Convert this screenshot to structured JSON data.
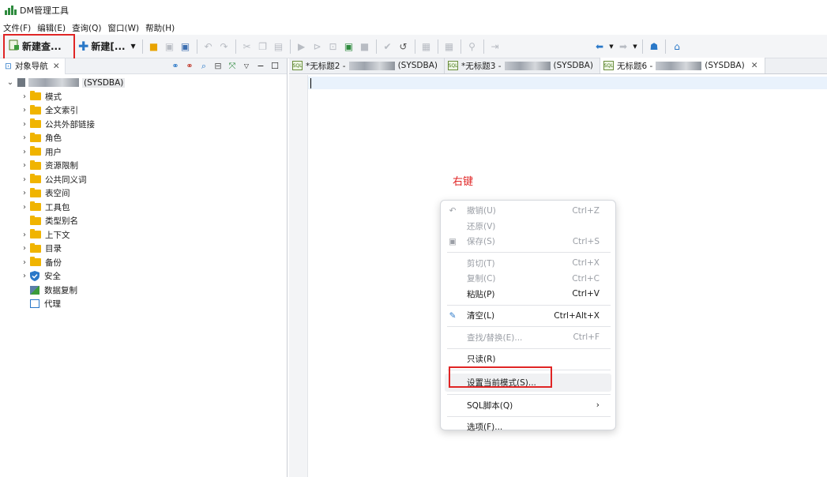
{
  "app": {
    "title": "DM管理工具"
  },
  "menubar": [
    "文件(F)",
    "编辑(E)",
    "查询(Q)",
    "窗口(W)",
    "帮助(H)"
  ],
  "toolbar": {
    "new_query": "新建查...",
    "new_other": "新建[..."
  },
  "nav": {
    "tab_label": "对象导航",
    "root_label": "(SYSDBA)",
    "items": [
      {
        "label": "模式",
        "icon": "folder"
      },
      {
        "label": "全文索引",
        "icon": "folder"
      },
      {
        "label": "公共外部链接",
        "icon": "folder"
      },
      {
        "label": "角色",
        "icon": "folder"
      },
      {
        "label": "用户",
        "icon": "folder"
      },
      {
        "label": "资源限制",
        "icon": "folder"
      },
      {
        "label": "公共同义词",
        "icon": "folder"
      },
      {
        "label": "表空间",
        "icon": "folder"
      },
      {
        "label": "工具包",
        "icon": "folder"
      },
      {
        "label": "类型别名",
        "icon": "folder"
      },
      {
        "label": "上下文",
        "icon": "folder"
      },
      {
        "label": "目录",
        "icon": "folder"
      },
      {
        "label": "备份",
        "icon": "folder"
      },
      {
        "label": "安全",
        "icon": "shield"
      },
      {
        "label": "数据复制",
        "icon": "replication"
      },
      {
        "label": "代理",
        "icon": "agent"
      }
    ]
  },
  "editor": {
    "tabs": [
      {
        "prefix": "*无标题2 - ",
        "suffix": "(SYSDBA)"
      },
      {
        "prefix": "*无标题3 - ",
        "suffix": "(SYSDBA)"
      },
      {
        "prefix": "无标题6 - ",
        "suffix": "(SYSDBA)"
      }
    ],
    "sql_badge": "SQL"
  },
  "annotation": "右键",
  "context_menu": {
    "undo": {
      "label": "撤销(U)",
      "shortcut": "Ctrl+Z"
    },
    "redo": {
      "label": "还原(V)"
    },
    "save": {
      "label": "保存(S)",
      "shortcut": "Ctrl+S"
    },
    "cut": {
      "label": "剪切(T)",
      "shortcut": "Ctrl+X"
    },
    "copy": {
      "label": "复制(C)",
      "shortcut": "Ctrl+C"
    },
    "paste": {
      "label": "粘贴(P)",
      "shortcut": "Ctrl+V"
    },
    "clear": {
      "label": "清空(L)",
      "shortcut": "Ctrl+Alt+X"
    },
    "find": {
      "label": "查找/替换(E)...",
      "shortcut": "Ctrl+F"
    },
    "readonly": {
      "label": "只读(R)"
    },
    "set_schema": {
      "label": "设置当前模式(S)..."
    },
    "sql_script": {
      "label": "SQL脚本(Q)"
    },
    "options": {
      "label": "选项(F)..."
    }
  },
  "colors": {
    "highlight_box": "#e02525",
    "folder": "#f0b400",
    "accent": "#2a78c8"
  }
}
